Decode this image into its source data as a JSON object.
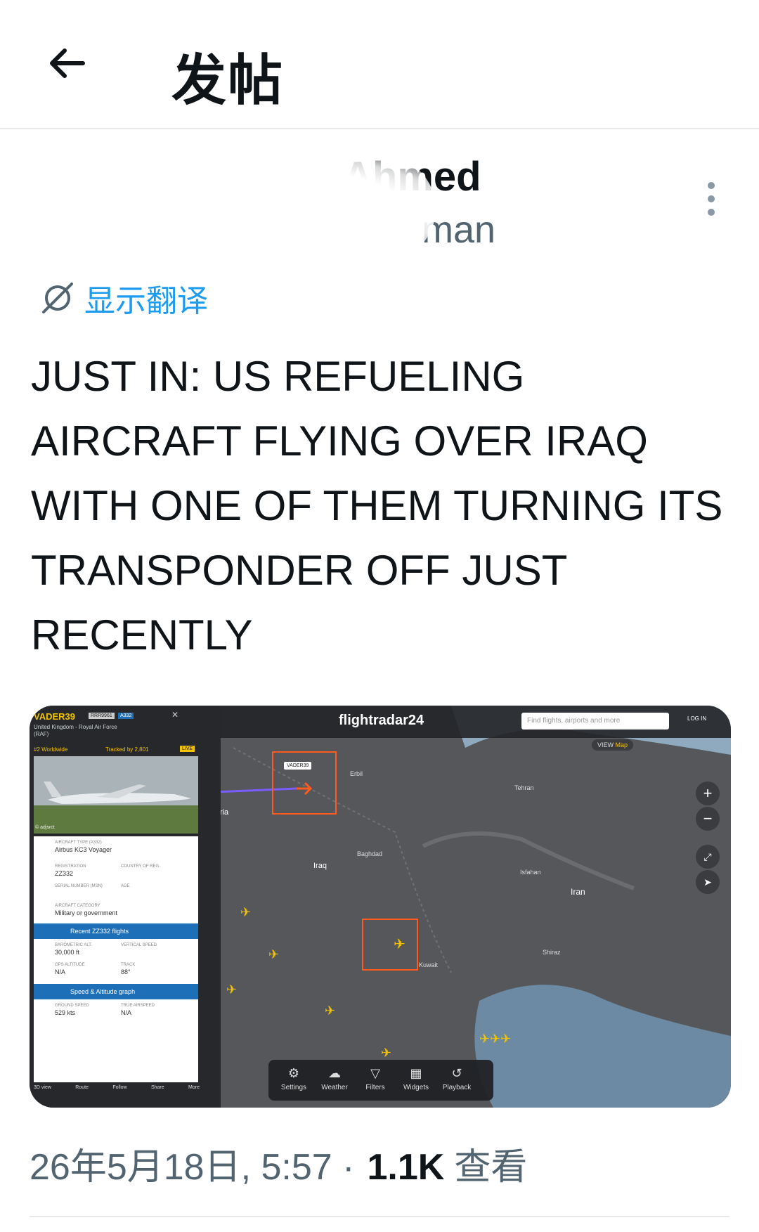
{
  "header": {
    "title": "发帖",
    "back_icon": "arrow-left-icon"
  },
  "author": {
    "name": "Ahmed",
    "handle": "man"
  },
  "translate": {
    "label": "显示翻译"
  },
  "post": {
    "text": "JUST IN: US REFUELING AIRCRAFT FLYING OVER IRAQ WITH ONE OF THEM TURNING ITS TRANSPONDER OFF JUST RECENTLY"
  },
  "media": {
    "logo": "flightradar24",
    "search_placeholder": "Find flights, airports and more",
    "login": "LOG IN",
    "view_label": "VIEW",
    "view_value": "Map",
    "flight": {
      "callsign": "VADER39",
      "badge1": "RRR9961",
      "badge2": "A332",
      "operator": "United Kingdom - Royal Air Force",
      "operator_short": "(RAF)",
      "worldwide": "#2 Worldwide",
      "tracked": "Tracked by 2,801",
      "live": "LIVE",
      "photo_credit": "© adjsrct",
      "aircraft_type_label": "AIRCRAFT TYPE (A332)",
      "aircraft_type": "Airbus KC3 Voyager",
      "registration_label": "REGISTRATION",
      "registration": "ZZ332",
      "country_label": "COUNTRY OF REG.",
      "serial_label": "SERIAL NUMBER (MSN)",
      "age_label": "AGE",
      "category_label": "AIRCRAFT CATEGORY",
      "category": "Military or government",
      "recent_flights": "Recent ZZ332 flights",
      "baro_label": "BAROMETRIC ALT.",
      "baro": "30,000 ft",
      "vs_label": "VERTICAL SPEED",
      "gps_label": "GPS ALTITUDE",
      "gps": "N/A",
      "track_label": "TRACK",
      "track": "88°",
      "speed_graph": "Speed & Altitude graph",
      "gs_label": "GROUND SPEED",
      "gs": "529 kts",
      "tas_label": "TRUE AIRSPEED",
      "tas": "N/A"
    },
    "panel_actions": [
      "3D view",
      "Route",
      "Follow",
      "Share",
      "More"
    ],
    "bottom_bar": [
      "Settings",
      "Weather",
      "Filters",
      "Widgets",
      "Playback"
    ],
    "map_labels": [
      "Syria",
      "Iraq",
      "Iran",
      "Baghdad",
      "Erbil",
      "Tehran",
      "Isfahan",
      "Shiraz",
      "Kuwait"
    ],
    "vader_tag": "VADER39"
  },
  "footer": {
    "timestamp": "26年5月18日, 5:57 ·",
    "views_count": "1.1K",
    "views_label": "查看"
  }
}
